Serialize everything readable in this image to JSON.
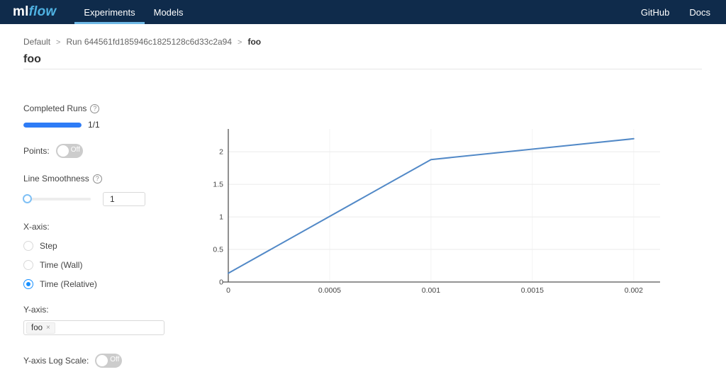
{
  "navbar": {
    "logo_ml": "ml",
    "logo_flow": "flow",
    "tabs": [
      {
        "label": "Experiments",
        "active": true
      },
      {
        "label": "Models",
        "active": false
      }
    ],
    "links": [
      "GitHub",
      "Docs"
    ]
  },
  "breadcrumb": {
    "items": [
      "Default",
      "Run 644561fd185946c1825128c6d33c2a94",
      "foo"
    ],
    "separator": ">"
  },
  "page": {
    "title": "foo"
  },
  "controls": {
    "completed_runs": {
      "label": "Completed Runs",
      "help_icon": "?",
      "progress_percent": 100,
      "count": "1/1"
    },
    "points": {
      "label": "Points:",
      "state": "Off"
    },
    "line_smoothness": {
      "label": "Line Smoothness",
      "help_icon": "?",
      "value": "1"
    },
    "x_axis": {
      "label": "X-axis:",
      "options": [
        {
          "label": "Step",
          "selected": false
        },
        {
          "label": "Time (Wall)",
          "selected": false
        },
        {
          "label": "Time (Relative)",
          "selected": true
        }
      ]
    },
    "y_axis": {
      "label": "Y-axis:",
      "tags": [
        {
          "label": "foo",
          "remove": "×"
        }
      ]
    },
    "y_log": {
      "label": "Y-axis Log Scale:",
      "state": "Off"
    }
  },
  "chart_data": {
    "type": "line",
    "title": "",
    "xlabel": "",
    "ylabel": "",
    "series": [
      {
        "name": "foo",
        "x": [
          0,
          0.001,
          0.002
        ],
        "y": [
          0.135,
          1.88,
          2.2
        ]
      }
    ],
    "x_ticks": [
      0,
      0.0005,
      0.001,
      0.0015,
      0.002
    ],
    "x_tick_labels": [
      "0",
      "0.0005",
      "0.001",
      "0.0015",
      "0.002"
    ],
    "y_ticks": [
      0,
      0.5,
      1,
      1.5,
      2
    ],
    "y_tick_labels": [
      "0",
      "0.5",
      "1",
      "1.5",
      "2"
    ],
    "xlim": [
      0,
      0.00213
    ],
    "ylim": [
      0,
      2.35
    ],
    "grid": true,
    "legend": false,
    "line_color": "#5289c7",
    "axis_color": "#555555",
    "hgrid_color": "#ebebeb",
    "vgrid_color": "#f4f4f4",
    "tick_color": "#444444"
  },
  "colors": {
    "navbar_bg": "#0f2b4b",
    "accent_blue": "#1890ff",
    "progress_blue": "#2e7cf6",
    "tab_underline": "#6fb9e6",
    "logo_flow_blue": "#4fb2e2"
  }
}
